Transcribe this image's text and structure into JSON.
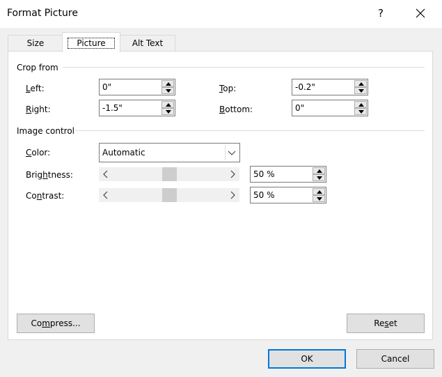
{
  "dialog": {
    "title": "Format Picture",
    "help_glyph": "?"
  },
  "tabs": [
    {
      "label": "Size",
      "active": false
    },
    {
      "label": "Picture",
      "active": true
    },
    {
      "label": "Alt Text",
      "active": false
    }
  ],
  "crop": {
    "group_label": "Crop from",
    "left": {
      "label_key": "L",
      "label_rest": "eft:",
      "value": "0\""
    },
    "right": {
      "label_key": "R",
      "label_rest": "ight:",
      "value": "-1.5\""
    },
    "top": {
      "label_key": "T",
      "label_rest": "op:",
      "value": "-0.2\""
    },
    "bottom": {
      "label_key": "B",
      "label_rest": "ottom:",
      "value": "0\""
    }
  },
  "image_control": {
    "group_label": "Image control",
    "color": {
      "label_key": "C",
      "label_rest": "olor:",
      "value": "Automatic"
    },
    "brightness": {
      "label_pre": "Brig",
      "label_key": "h",
      "label_rest": "tness:",
      "value": "50 %",
      "level": 0.5
    },
    "contrast": {
      "label_pre": "Co",
      "label_key": "n",
      "label_rest": "trast:",
      "value": "50 %",
      "level": 0.5
    }
  },
  "buttons": {
    "compress": {
      "pre": "Co",
      "key": "m",
      "rest": "press..."
    },
    "reset": {
      "pre": "Re",
      "key": "s",
      "rest": "et"
    },
    "ok": "OK",
    "cancel": "Cancel"
  },
  "icons": {
    "help": "help-icon",
    "close": "close-icon",
    "spin_up": "triangle-up-icon",
    "spin_down": "triangle-down-icon",
    "dropdown": "chevron-down-icon",
    "slider_left": "chevron-left-icon",
    "slider_right": "chevron-right-icon"
  },
  "colors": {
    "accent": "#0078d7",
    "window_bg": "#f0f0f0",
    "panel_bg": "#ffffff"
  }
}
